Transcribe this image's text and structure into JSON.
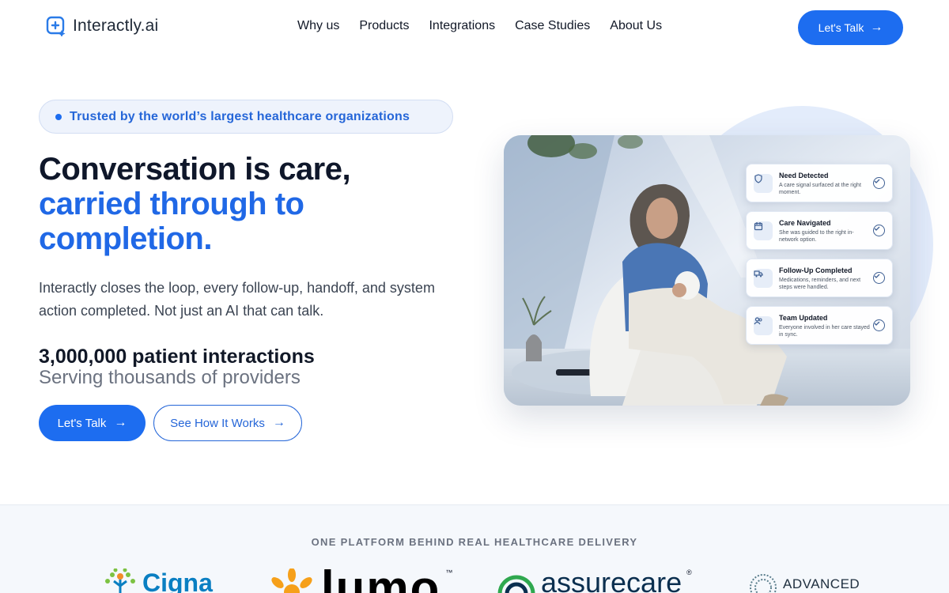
{
  "nav": {
    "logo_text": "Interactly.ai",
    "links": [
      "Why us",
      "Products",
      "Integrations",
      "Case Studies",
      "About Us"
    ],
    "cta_label": "Let's Talk"
  },
  "hero": {
    "badge": "Trusted by the world’s largest healthcare organizations",
    "headline_line1": "Conversation is care,",
    "headline_line2": "carried through to",
    "headline_line3": "completion.",
    "subtext": "Interactly closes the loop, every follow-up, handoff, and system action completed. Not just an AI that can talk.",
    "stat_main": "3,000,000 patient interactions",
    "stat_sub": "Serving thousands of providers",
    "primary_button": "Let's Talk",
    "secondary_button": "See How It Works"
  },
  "cards": [
    {
      "icon": "shield-icon",
      "title": "Need Detected",
      "desc": "A care signal surfaced at the right moment."
    },
    {
      "icon": "calendar-icon",
      "title": "Care Navigated",
      "desc": "She was guided to the right in-network option."
    },
    {
      "icon": "truck-icon",
      "title": "Follow-Up Completed",
      "desc": "Medications, reminders, and next steps were handled."
    },
    {
      "icon": "users-icon",
      "title": "Team Updated",
      "desc": "Everyone involved in her care stayed in sync."
    }
  ],
  "logos_section": {
    "title": "ONE PLATFORM BEHIND REAL HEALTHCARE DELIVERY",
    "brands": [
      "Cigna",
      "lumo",
      "assurecare",
      "ADVANCED"
    ]
  },
  "colors": {
    "accent": "#1d6df0",
    "headline_blue": "#2068e6",
    "text_dark": "#0f172a"
  }
}
